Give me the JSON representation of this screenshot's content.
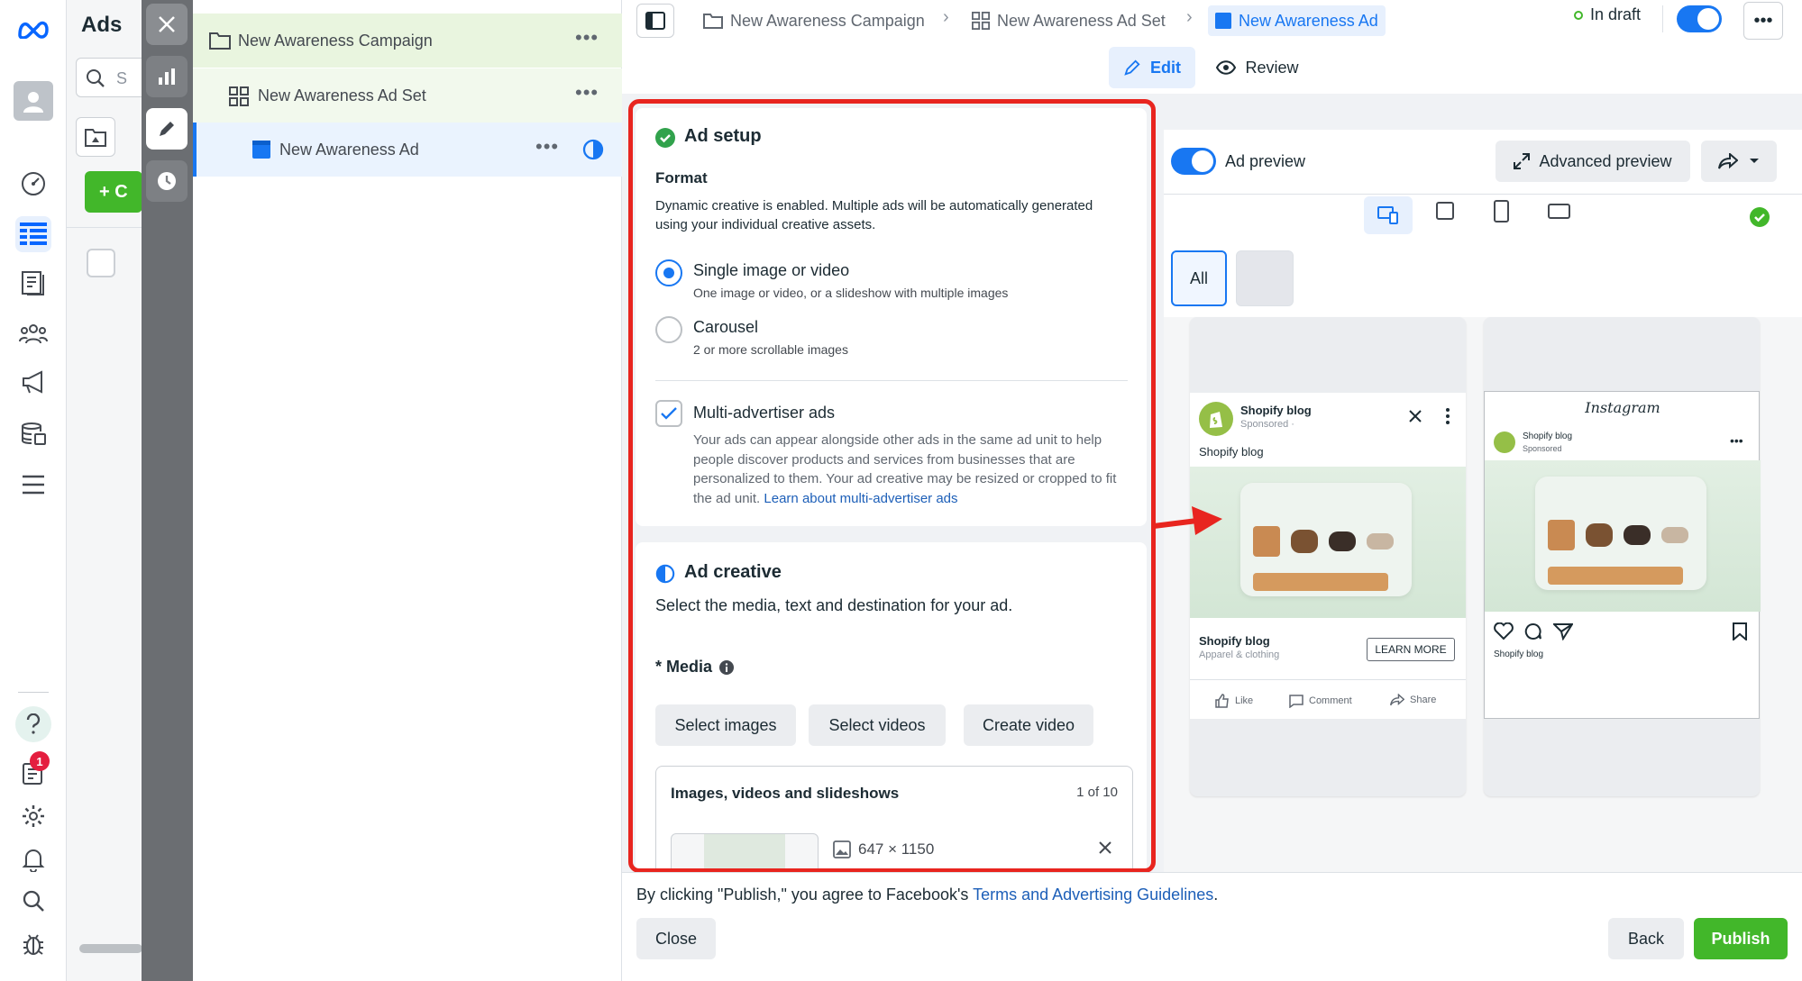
{
  "nav": {
    "notifications_count": "1"
  },
  "col2": {
    "title": "Ads",
    "search_placeholder": "S",
    "create_label": "+ C"
  },
  "tree": {
    "campaign": "New Awareness Campaign",
    "adset": "New Awareness Ad Set",
    "ad": "New Awareness Ad"
  },
  "breadcrumb": {
    "campaign": "New Awareness Campaign",
    "adset": "New Awareness Ad Set",
    "ad": "New Awareness Ad"
  },
  "status": {
    "label": "In draft"
  },
  "tabs": {
    "edit": "Edit",
    "review": "Review"
  },
  "ad_setup": {
    "title": "Ad setup",
    "format_label": "Format",
    "format_desc": "Dynamic creative is enabled. Multiple ads will be automatically generated using your individual creative assets.",
    "options": [
      {
        "label": "Single image or video",
        "desc": "One image or video, or a slideshow with multiple images"
      },
      {
        "label": "Carousel",
        "desc": "2 or more scrollable images"
      }
    ],
    "multi_label": "Multi-advertiser ads",
    "multi_desc": "Your ads can appear alongside other ads in the same ad unit to help people discover products and services from businesses that are personalized to them. Your ad creative may be resized or cropped to fit the ad unit. ",
    "multi_link": "Learn about multi-advertiser ads"
  },
  "ad_creative": {
    "title": "Ad creative",
    "desc": "Select the media, text and destination for your ad.",
    "media_label": "* Media",
    "buttons": [
      "Select images",
      "Select videos",
      "Create video"
    ],
    "assets_title": "Images, videos and slideshows",
    "assets_count": "1 of 10",
    "asset_size": "647 × 1150"
  },
  "preview": {
    "toggle_label": "Ad preview",
    "advanced_label": "Advanced preview",
    "filter_all": "All",
    "fb": {
      "page": "Shopify blog",
      "sponsored": "Sponsored · ",
      "text": "Shopify blog",
      "headline": "Shopify blog",
      "sub": "Apparel & clothing",
      "cta": "LEARN MORE",
      "actions": [
        "Like",
        "Comment",
        "Share"
      ]
    },
    "ig": {
      "logo": "Instagram",
      "page": "Shopify blog",
      "sponsored": "Sponsored",
      "caption": "Shopify blog"
    }
  },
  "footer": {
    "notice": "By clicking \"Publish,\" you agree to Facebook's ",
    "link": "Terms and Advertising Guidelines",
    "period": ".",
    "close": "Close",
    "back": "Back",
    "publish": "Publish"
  },
  "colors": {
    "accent": "#1877f2",
    "publish": "#42b72a",
    "highlight": "#e8251f"
  }
}
